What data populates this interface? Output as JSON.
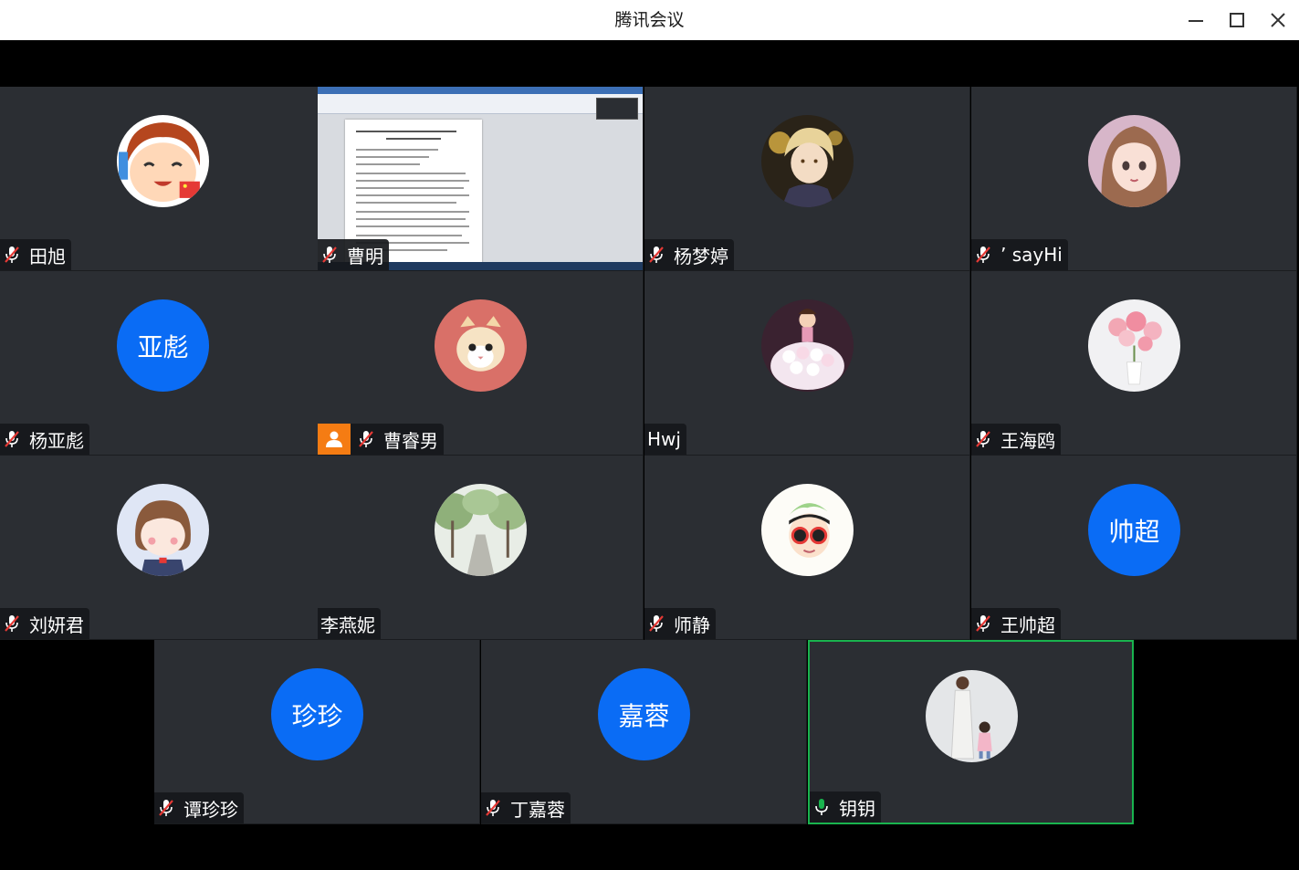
{
  "window": {
    "title": "腾讯会议",
    "controls": [
      "minimize-icon",
      "maximize-icon",
      "close-icon"
    ]
  },
  "colors": {
    "tile_bg": "#2b2e33",
    "avatar_blue": "#0a6cf5",
    "active_speaker_border": "#19b34e",
    "host_badge": "#f57c13",
    "mic_on": "#19b34e"
  },
  "participants": [
    {
      "name": "田旭",
      "mic": "muted",
      "avatar": "cartoon-boy-avatar"
    },
    {
      "name": "曹明",
      "mic": "muted",
      "avatar": "screen-share-document"
    },
    {
      "name": "杨梦婷",
      "mic": "muted",
      "avatar": "anime-character-avatar"
    },
    {
      "name": "’ sayHi",
      "mic": "muted",
      "avatar": "anime-girl-avatar"
    },
    {
      "name": "杨亚彪",
      "mic": "muted",
      "avatar_text": "亚彪"
    },
    {
      "name": "曹睿男",
      "mic": "muted",
      "host": true,
      "avatar": "cat-avatar"
    },
    {
      "name": "Hwj",
      "mic": "none",
      "avatar": "cake-avatar"
    },
    {
      "name": "王海鸥",
      "mic": "muted",
      "avatar": "flowers-avatar"
    },
    {
      "name": "刘妍君",
      "mic": "muted",
      "avatar": "cartoon-girl-avatar"
    },
    {
      "name": "李燕妮",
      "mic": "none",
      "avatar": "trees-street-avatar"
    },
    {
      "name": "师静",
      "mic": "muted",
      "avatar": "sunglasses-cartoon-avatar"
    },
    {
      "name": "王帅超",
      "mic": "muted",
      "avatar_text": "帅超"
    },
    {
      "name": "谭珍珍",
      "mic": "muted",
      "avatar_text": "珍珍"
    },
    {
      "name": "丁嘉蓉",
      "mic": "muted",
      "avatar_text": "嘉蓉"
    },
    {
      "name": "钥钥",
      "mic": "speaking",
      "active": true,
      "avatar": "mother-child-photo-avatar"
    }
  ]
}
